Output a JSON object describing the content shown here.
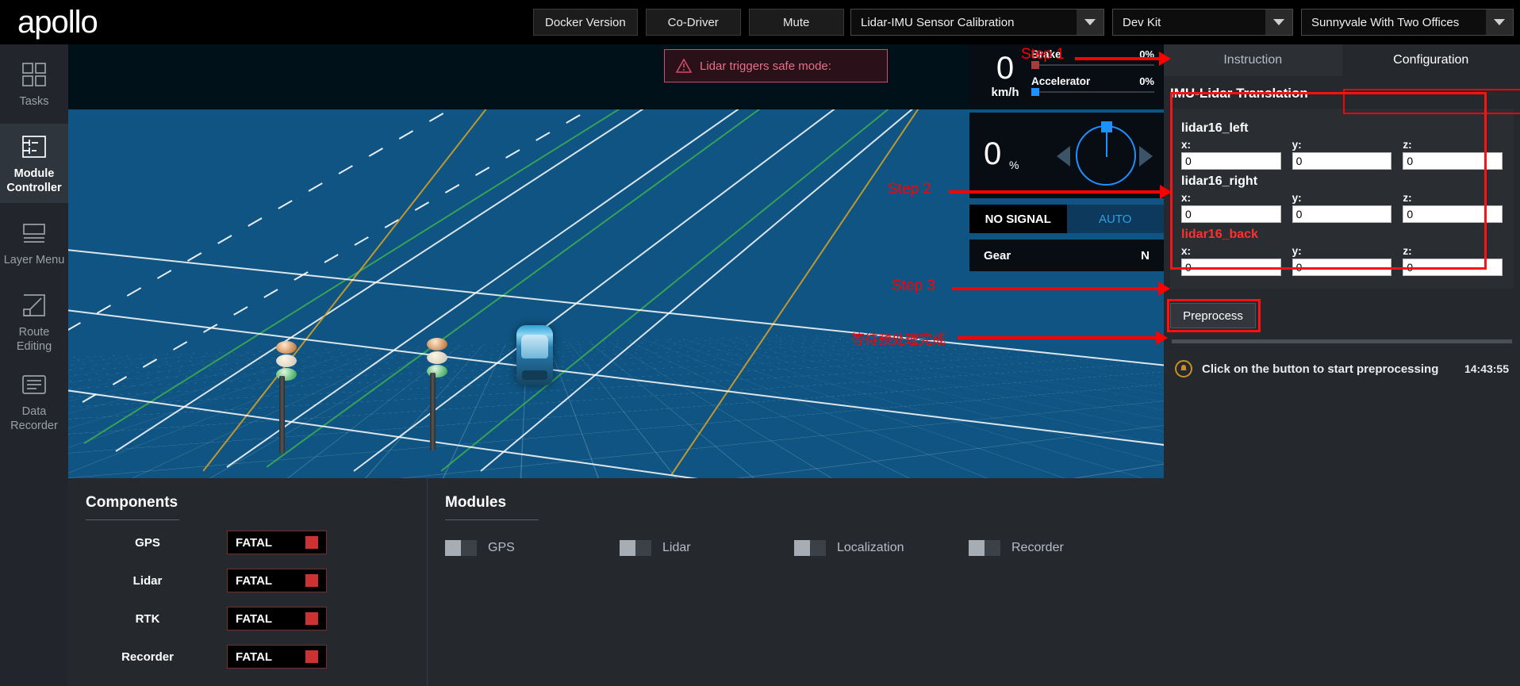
{
  "header": {
    "logo": "apollo",
    "buttons": [
      {
        "label": "Docker Version"
      },
      {
        "label": "Co-Driver"
      },
      {
        "label": "Mute"
      }
    ],
    "selects": [
      {
        "name": "task-select",
        "value": "Lidar-IMU Sensor Calibration"
      },
      {
        "name": "vehicle-select",
        "value": "Dev Kit"
      },
      {
        "name": "map-select",
        "value": "Sunnyvale With Two Offices"
      }
    ]
  },
  "sidebar": {
    "items": [
      {
        "label": "Tasks",
        "icon": "grid-icon",
        "active": false
      },
      {
        "label": "Module Controller",
        "icon": "module-icon",
        "active": true
      },
      {
        "label": "Layer Menu",
        "icon": "layers-icon",
        "active": false
      },
      {
        "label": "Route Editing",
        "icon": "route-icon",
        "active": false
      },
      {
        "label": "Data Recorder",
        "icon": "recorder-icon",
        "active": false
      }
    ]
  },
  "scene": {
    "warning": "Lidar triggers safe mode:"
  },
  "hud": {
    "speed_value": "0",
    "speed_unit": "km/h",
    "brake_label": "Brake",
    "brake_value": "0%",
    "accelerator_label": "Accelerator",
    "accelerator_value": "0%",
    "wheel_value": "0",
    "wheel_unit": "%",
    "signal_label": "NO SIGNAL",
    "auto_label": "AUTO",
    "gear_label": "Gear",
    "gear_value": "N"
  },
  "right_panel": {
    "tabs": [
      {
        "label": "Instruction",
        "active": false
      },
      {
        "label": "Configuration",
        "active": true
      }
    ],
    "section_title": "IMU-Lidar Translation",
    "groups": [
      {
        "name": "lidar16_left",
        "error": false,
        "fields": [
          {
            "label": "x:",
            "value": "0"
          },
          {
            "label": "y:",
            "value": "0"
          },
          {
            "label": "z:",
            "value": "0"
          }
        ]
      },
      {
        "name": "lidar16_right",
        "error": false,
        "fields": [
          {
            "label": "x:",
            "value": "0"
          },
          {
            "label": "y:",
            "value": "0"
          },
          {
            "label": "z:",
            "value": "0"
          }
        ]
      },
      {
        "name": "lidar16_back",
        "error": true,
        "fields": [
          {
            "label": "x:",
            "value": "0"
          },
          {
            "label": "y:",
            "value": "0"
          },
          {
            "label": "z:",
            "value": "0"
          }
        ]
      }
    ],
    "preprocess_label": "Preprocess",
    "message": "Click on the button to start preprocessing",
    "message_time": "14:43:55"
  },
  "components_panel": {
    "title": "Components",
    "rows": [
      {
        "name": "GPS",
        "status": "FATAL"
      },
      {
        "name": "Lidar",
        "status": "FATAL"
      },
      {
        "name": "RTK",
        "status": "FATAL"
      },
      {
        "name": "Recorder",
        "status": "FATAL"
      }
    ]
  },
  "modules_panel": {
    "title": "Modules",
    "items": [
      {
        "label": "GPS",
        "on": false
      },
      {
        "label": "Lidar",
        "on": false
      },
      {
        "label": "Localization",
        "on": false
      },
      {
        "label": "Recorder",
        "on": false
      }
    ]
  },
  "annotations": [
    {
      "text": "Step 1"
    },
    {
      "text": "Step 2"
    },
    {
      "text": "Step 3"
    },
    {
      "text": "等待预处理完成"
    }
  ],
  "colors": {
    "accent_red": "#ff0000",
    "status_fatal": "#cc3232",
    "auto_blue": "#2f9fe0",
    "scene_blue": "#0f5482"
  }
}
